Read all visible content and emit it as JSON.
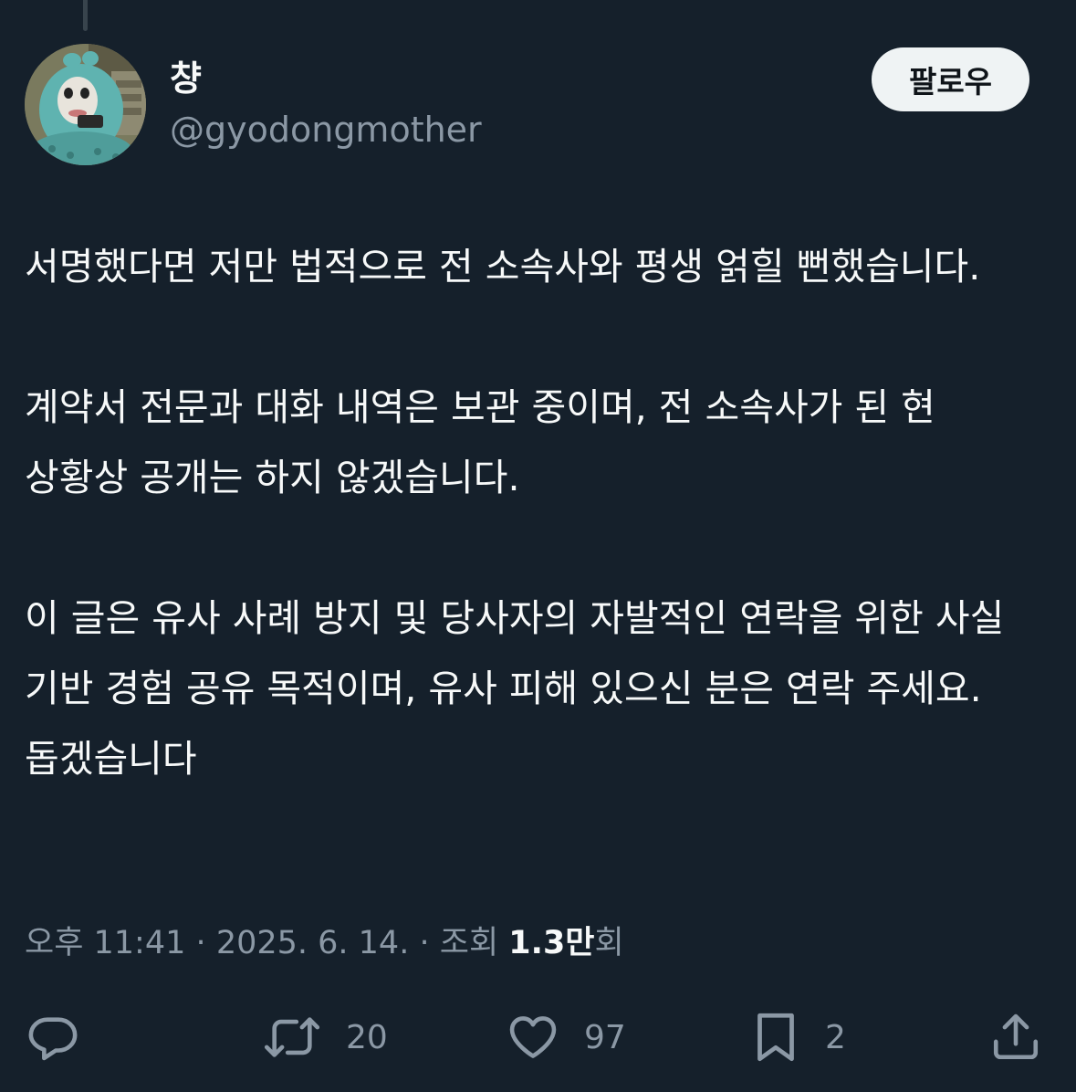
{
  "author": {
    "display_name": "챵",
    "handle": "@gyodongmother"
  },
  "follow_button": {
    "label": "팔로우"
  },
  "tweet": {
    "paragraphs": [
      "서명했다면 저만 법적으로 전 소속사와 평생 얽힐 뻔했습니다.",
      "계약서 전문과 대화 내역은 보관 중이며, 전 소속사가 된 현 상황상 공개는 하지 않겠습니다.",
      "이 글은 유사 사례 방지 및 당사자의 자발적인 연락을 위한 사실 기반 경험 공유 목적이며, 유사 피해 있으신 분은 연락 주세요. 돕겠습니다"
    ]
  },
  "meta": {
    "time": "오후 11:41",
    "separator": "·",
    "date": "2025. 6. 14.",
    "views_prefix": "조회",
    "views_count": "1.3만",
    "views_suffix": "회"
  },
  "actions": {
    "reply": {
      "icon": "reply-icon",
      "count": ""
    },
    "retweet": {
      "icon": "retweet-icon",
      "count": "20"
    },
    "like": {
      "icon": "heart-icon",
      "count": "97"
    },
    "bookmark": {
      "icon": "bookmark-icon",
      "count": "2"
    },
    "share": {
      "icon": "share-icon",
      "count": ""
    }
  },
  "colors": {
    "background": "#15202b",
    "text_primary": "#f7f9f9",
    "text_secondary": "#8b98a5",
    "button_background": "#eff3f4",
    "button_text": "#0f1419",
    "thread_line": "#38444d"
  }
}
